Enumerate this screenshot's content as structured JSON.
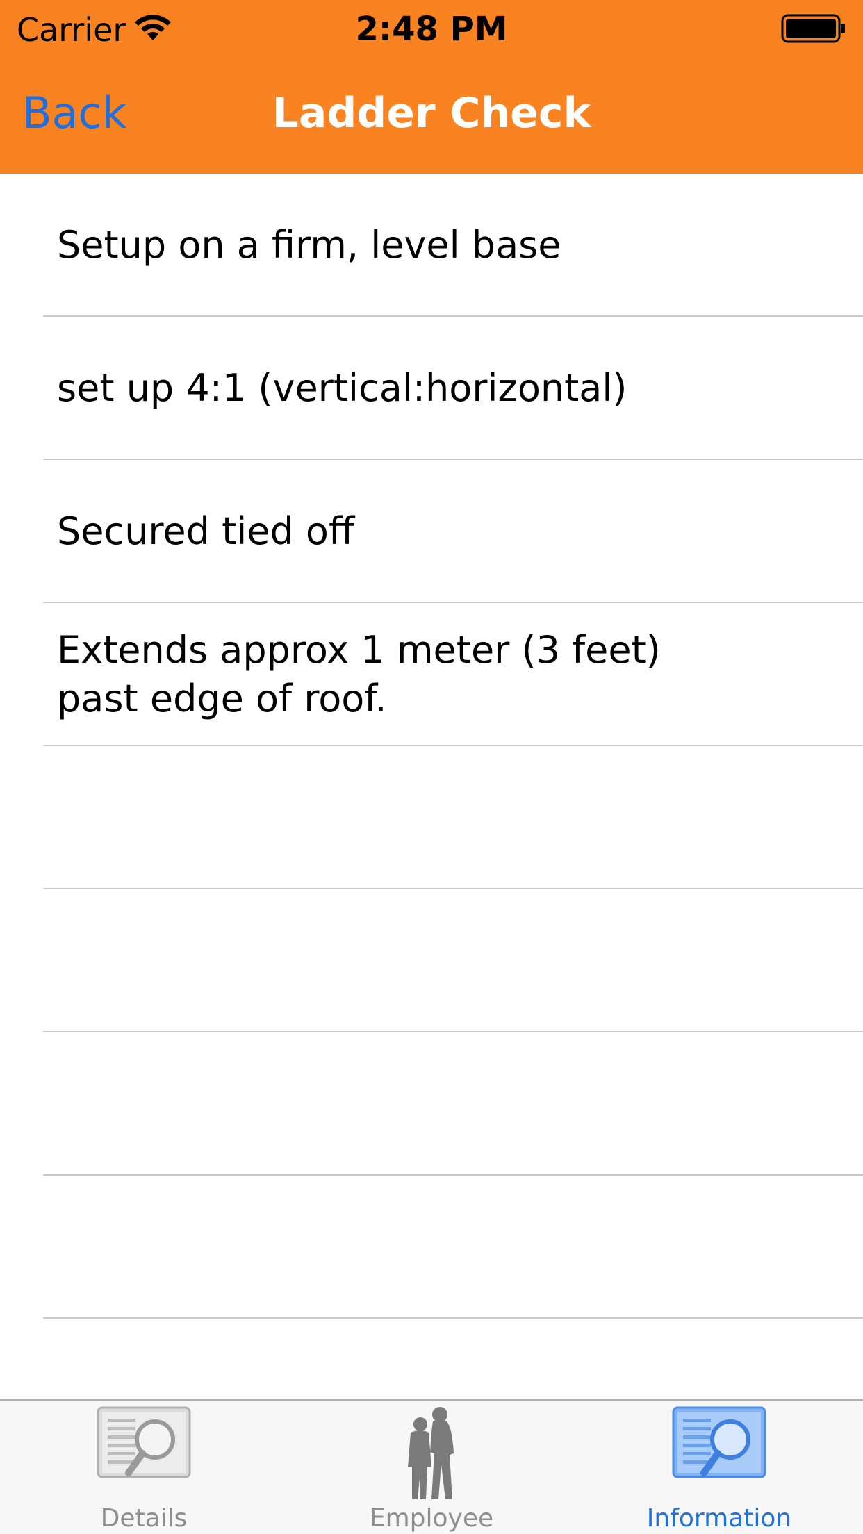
{
  "status_bar": {
    "carrier": "Carrier",
    "time": "2:48 PM"
  },
  "nav": {
    "back_label": "Back",
    "title": "Ladder Check"
  },
  "checklist": {
    "items": [
      "Setup on a firm, level base",
      "set up 4:1 (vertical:horizontal)",
      "Secured tied off",
      "Extends approx 1 meter (3 feet)\npast edge of roof.",
      "",
      "",
      "",
      ""
    ]
  },
  "tab_bar": {
    "tabs": [
      {
        "label": "Details",
        "icon": "document-search-icon",
        "active": false
      },
      {
        "label": "Employee",
        "icon": "people-silhouette-icon",
        "active": false
      },
      {
        "label": "Information",
        "icon": "document-search-icon",
        "active": true
      }
    ]
  },
  "colors": {
    "header": "#f98221",
    "accent": "#1e6fe0",
    "title": "#ffffff"
  }
}
